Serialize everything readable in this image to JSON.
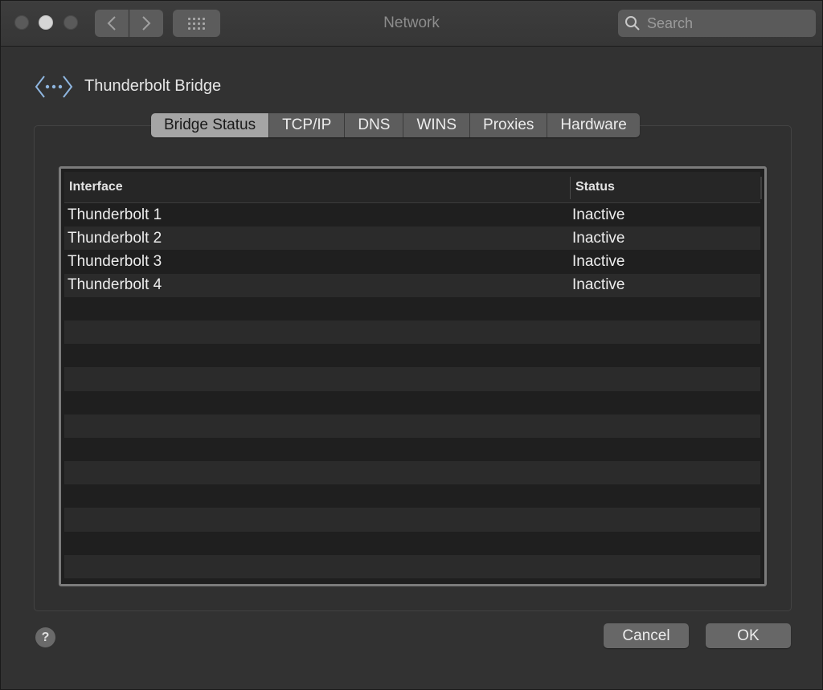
{
  "window": {
    "title": "Network"
  },
  "search": {
    "placeholder": "Search"
  },
  "header": {
    "title": "Thunderbolt Bridge"
  },
  "tabs": [
    {
      "label": "Bridge Status",
      "active": true
    },
    {
      "label": "TCP/IP"
    },
    {
      "label": "DNS"
    },
    {
      "label": "WINS"
    },
    {
      "label": "Proxies"
    },
    {
      "label": "Hardware"
    }
  ],
  "table": {
    "columns": [
      "Interface",
      "Status"
    ],
    "rows": [
      [
        "Thunderbolt 1",
        "Inactive"
      ],
      [
        "Thunderbolt 2",
        "Inactive"
      ],
      [
        "Thunderbolt 3",
        "Inactive"
      ],
      [
        "Thunderbolt 4",
        "Inactive"
      ]
    ]
  },
  "buttons": {
    "help": "?",
    "cancel": "Cancel",
    "ok": "OK"
  },
  "icons": {
    "back": "chevron-left-icon",
    "forward": "chevron-right-icon",
    "show_all": "grid-icon",
    "search": "search-icon",
    "service": "thunderbolt-bridge-icon"
  }
}
